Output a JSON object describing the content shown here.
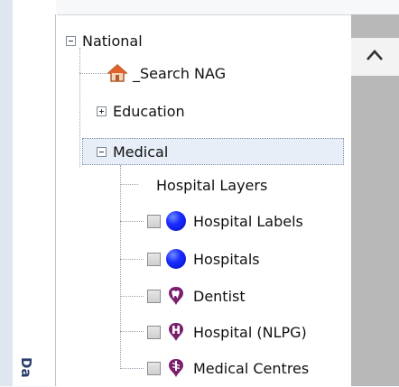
{
  "tree": {
    "national": {
      "label": "National",
      "expanded": true
    },
    "search": {
      "label": "_Search NAG",
      "icon": "home-icon"
    },
    "education": {
      "label": "Education",
      "expanded": false
    },
    "medical": {
      "label": "Medical",
      "expanded": true
    },
    "hospital_layers": {
      "label": "Hospital Layers"
    },
    "layers": [
      {
        "label": "Hospital Labels",
        "icon": "blue-circle-icon"
      },
      {
        "label": "Hospitals",
        "icon": "blue-circle-icon"
      },
      {
        "label": "Dentist",
        "icon": "tooth-pin-icon"
      },
      {
        "label": "Hospital (NLPG)",
        "icon": "h-pin-icon"
      },
      {
        "label": "Medical Centres",
        "icon": "medical-pin-icon"
      }
    ]
  },
  "side_tab": {
    "label": "Da"
  },
  "colors": {
    "pin_purple": "#7a1f6e",
    "ball_blue": "#1a2cff",
    "selection": "#e8eef8"
  }
}
